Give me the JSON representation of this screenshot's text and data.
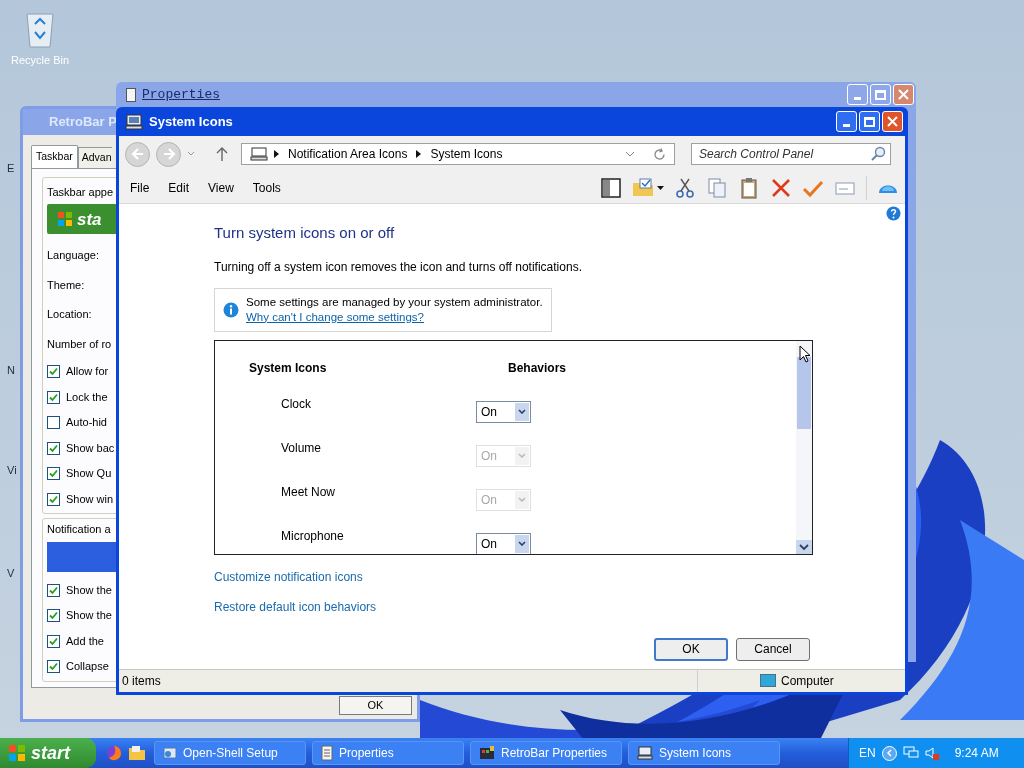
{
  "desktop": {
    "icons": [
      {
        "label": "Recycle Bin"
      }
    ],
    "partial_labels": [
      "E",
      "N",
      "Vi",
      "V"
    ]
  },
  "retrobar_window": {
    "title": "RetroBar P",
    "tabs": [
      {
        "label": "Taskbar",
        "selected": true
      },
      {
        "label": "Advan",
        "selected": false
      }
    ],
    "appearance_group": "Taskbar appe",
    "start_preview": "sta",
    "fields": [
      "Language:",
      "Theme:",
      "Location:",
      "Number of ro"
    ],
    "options": [
      {
        "label": "Allow for",
        "checked": true
      },
      {
        "label": "Lock the",
        "checked": true
      },
      {
        "label": "Auto-hid",
        "checked": false
      },
      {
        "label": "Show bac",
        "checked": true
      },
      {
        "label": "Show Qu",
        "checked": true
      },
      {
        "label": "Show win",
        "checked": true
      }
    ],
    "notification_group": "Notification a",
    "notification_options": [
      {
        "label": "Show the",
        "checked": true
      },
      {
        "label": "Show the",
        "checked": true
      },
      {
        "label": "Add the",
        "checked": true
      },
      {
        "label": "Collapse",
        "checked": true
      }
    ],
    "ok": "OK"
  },
  "properties_window": {
    "title": "Properties"
  },
  "system_icons_window": {
    "title": "System Icons",
    "breadcrumb": [
      "Notification Area Icons",
      "System Icons"
    ],
    "search": {
      "placeholder": "Search Control Panel"
    },
    "menu": [
      "File",
      "Edit",
      "View",
      "Tools"
    ],
    "heading": "Turn system icons on or off",
    "description": "Turning off a system icon removes the icon and turns off notifications.",
    "notice": {
      "text": "Some settings are managed by your system administrator.",
      "link": "Why can't I change some settings?"
    },
    "list": {
      "columns": [
        "System Icons",
        "Behaviors"
      ],
      "rows": [
        {
          "name": "Clock",
          "value": "On",
          "disabled": false
        },
        {
          "name": "Volume",
          "value": "On",
          "disabled": true
        },
        {
          "name": "Meet Now",
          "value": "On",
          "disabled": true
        },
        {
          "name": "Microphone",
          "value": "On",
          "disabled": false
        }
      ]
    },
    "links": [
      "Customize notification icons",
      "Restore default icon behaviors"
    ],
    "buttons": [
      "OK",
      "Cancel"
    ],
    "status_bar": {
      "items": "0 items",
      "location": "Computer"
    }
  },
  "taskbar": {
    "start": "start",
    "tasks": [
      {
        "label": "Open-Shell Setup",
        "kind": "setup"
      },
      {
        "label": "Properties",
        "kind": "doc"
      },
      {
        "label": "RetroBar Properties",
        "kind": "retrobar"
      },
      {
        "label": "System Icons",
        "kind": "computer"
      }
    ],
    "language": "EN",
    "clock": "9:24 AM"
  }
}
